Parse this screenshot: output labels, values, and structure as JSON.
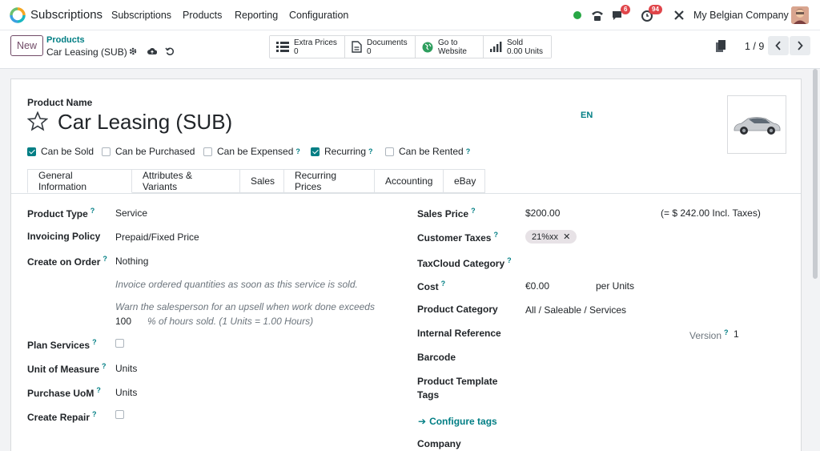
{
  "app": {
    "name": "Subscriptions"
  },
  "menu": [
    "Subscriptions",
    "Products",
    "Reporting",
    "Configuration"
  ],
  "systray": {
    "messages_count": "6",
    "activities_count": "94",
    "company": "My Belgian Company"
  },
  "control": {
    "new_label": "New",
    "breadcrumb_parent": "Products",
    "breadcrumb_current": "Car Leasing (SUB)",
    "smart_buttons": [
      {
        "label": "Extra Prices",
        "value": "0",
        "icon": "list-icon"
      },
      {
        "label": "Documents",
        "value": "0",
        "icon": "document-icon"
      },
      {
        "label": "Go to",
        "value": "Website",
        "icon": "globe-icon"
      },
      {
        "label": "Sold",
        "value": "0.00 Units",
        "icon": "bar-chart-icon"
      }
    ],
    "pager": "1 / 9"
  },
  "form": {
    "name_label": "Product Name",
    "name": "Car Leasing (SUB)",
    "lang": "EN",
    "checkboxes": [
      {
        "label": "Can be Sold",
        "checked": true
      },
      {
        "label": "Can be Purchased",
        "checked": false
      },
      {
        "label": "Can be Expensed",
        "checked": false,
        "help": "?"
      },
      {
        "label": "Recurring",
        "checked": true,
        "help": "?"
      },
      {
        "label": "Can be Rented",
        "checked": false,
        "help": "?"
      }
    ],
    "tabs": [
      "General Information",
      "Attributes & Variants",
      "Sales",
      "Recurring Prices",
      "Accounting",
      "eBay"
    ],
    "left": {
      "product_type_label": "Product Type",
      "product_type": "Service",
      "invoicing_policy_label": "Invoicing Policy",
      "invoicing_policy": "Prepaid/Fixed Price",
      "create_on_order_label": "Create on Order",
      "create_on_order": "Nothing",
      "help1": "Invoice ordered quantities as soon as this service is sold.",
      "help2": "Warn the salesperson for an upsell when work done exceeds",
      "upsell_value": "100",
      "help3": "% of hours sold. (1 Units = 1.00 Hours)",
      "plan_services_label": "Plan Services",
      "uom_label": "Unit of Measure",
      "uom": "Units",
      "purchase_uom_label": "Purchase UoM",
      "purchase_uom": "Units",
      "create_repair_label": "Create Repair"
    },
    "right": {
      "sales_price_label": "Sales Price",
      "sales_price": "$200.00",
      "incl_taxes": "(= $ 242.00 Incl. Taxes)",
      "customer_taxes_label": "Customer Taxes",
      "customer_tax_tag": "21%xx",
      "taxcloud_label": "TaxCloud Category",
      "cost_label": "Cost",
      "cost": "€0.00",
      "cost_unit": "per Units",
      "category_label": "Product Category",
      "category": "All / Saleable / Services",
      "internal_ref_label": "Internal Reference",
      "version_label": "Version",
      "version": "1",
      "barcode_label": "Barcode",
      "template_tags_label1": "Product Template",
      "template_tags_label2": "Tags",
      "configure_tags": "Configure tags",
      "company_label": "Company"
    }
  }
}
